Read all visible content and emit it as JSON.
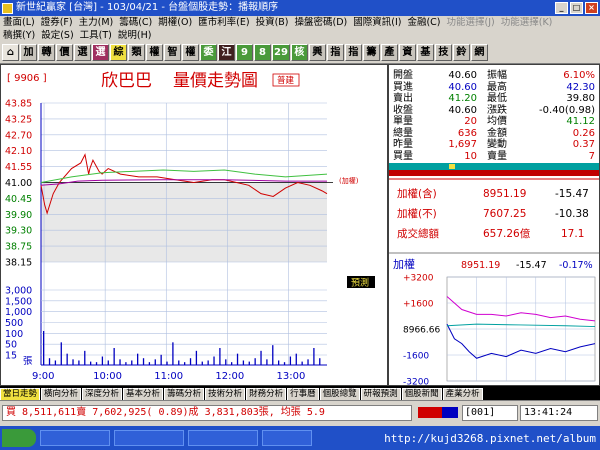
{
  "window": {
    "title": "新世紀贏家 [台灣] - 103/04/21 - 台盤個股走勢：播報順序"
  },
  "menu": {
    "row1": [
      "畫面(L)",
      "證券(F)",
      "主力(M)",
      "籌碼(C)",
      "期權(O)",
      "匯市利率(E)",
      "投資(B)",
      "操盤密碼(D)",
      "國際資訊(I)",
      "金融(C)",
      "功能選擇(J)",
      "功能選擇(K)"
    ],
    "row2": [
      "稿撰(Y)",
      "設定(S)",
      "工具(T)",
      "說明(H)"
    ]
  },
  "toolbar": [
    "加",
    "轉",
    "價",
    "選",
    "選",
    "綜",
    "類",
    "權",
    "智",
    "權",
    "委",
    "江",
    "9",
    "8",
    "29",
    "核",
    "興",
    "指",
    "指",
    "籌",
    "產",
    "資",
    "基",
    "技",
    "鈴",
    "網"
  ],
  "stock": {
    "code": "[ 9906 ]",
    "name": "欣巴巴",
    "chart_title": "量價走勢圖",
    "badge": "普建",
    "ref_label": "(加權)",
    "predict": "預測"
  },
  "quote": {
    "rows": [
      {
        "l1": "開盤",
        "v1": "40.60",
        "c1": "blk",
        "l2": "振幅",
        "v2": "6.10%",
        "c2": "red"
      },
      {
        "l1": "買進",
        "v1": "40.60",
        "c1": "blue",
        "l2": "最高",
        "v2": "42.30",
        "c2": "blue"
      },
      {
        "l1": "賣出",
        "v1": "41.20",
        "c1": "green",
        "l2": "最低",
        "v2": "39.80",
        "c2": "blk"
      },
      {
        "l1": "收盤",
        "v1": "40.60",
        "c1": "blk",
        "l2": "漲跌",
        "v2": "-0.40(0.98)",
        "c2": "blk"
      },
      {
        "l1": "單量",
        "v1": "20",
        "c1": "red",
        "l2": "均價",
        "v2": "41.12",
        "c2": "green"
      },
      {
        "l1": "總量",
        "v1": "636",
        "c1": "red",
        "l2": "金額",
        "v2": "0.26",
        "c2": "red"
      },
      {
        "l1": "昨量",
        "v1": "1,697",
        "c1": "red",
        "l2": "變動",
        "v2": "0.37",
        "c2": "red"
      },
      {
        "l1": "買量",
        "v1": "10",
        "c1": "red",
        "l2": "賣量",
        "v2": "7",
        "c2": "red"
      }
    ]
  },
  "index": {
    "r1": {
      "label": "加權(含)",
      "val": "8951.19",
      "chg": "-15.47"
    },
    "r2": {
      "label": "加權(不)",
      "val": "7607.25",
      "chg": "-10.38"
    },
    "r3": {
      "label": "成交總額",
      "val": "657.26億",
      "chg": "17.1"
    },
    "mini_label": "加權",
    "mini_val": "8951.19",
    "mini_chg": "-15.47",
    "mini_pct": "-0.17%",
    "mini_ticks": [
      "+3200",
      "+1600",
      "8966.66",
      "-1600",
      "-3200"
    ]
  },
  "tabs": [
    "當日走勢",
    "橫向分析",
    "深度分析",
    "基本分析",
    "籌碼分析",
    "技術分析",
    "財務分析",
    "行事曆",
    "個股總覽",
    "研報預測",
    "個股新聞",
    "產業分析"
  ],
  "status": {
    "line": "買 8,511,611賣 7,602,925( 0.89)成 3,831,803張, 均張 5.9",
    "code_box": "001",
    "time": "13:41:24"
  },
  "watermark": "http://kujd3268.pixnet.net/album",
  "chart_data": [
    {
      "type": "line",
      "title": "量價走勢圖",
      "y_ticks": [
        "43.85",
        "43.25",
        "42.70",
        "42.10",
        "41.55",
        "41.00",
        "40.45",
        "39.90",
        "39.30",
        "38.75",
        "38.15"
      ],
      "x_ticks": [
        "9:00",
        "10:00",
        "11:00",
        "12:00",
        "13:00"
      ],
      "ylim": [
        38.15,
        43.85
      ],
      "ref": 41.0,
      "series": [
        {
          "name": "price",
          "color": "#d00000",
          "x": [
            0,
            0.06,
            0.1,
            0.2,
            0.3,
            0.5,
            0.65,
            0.72,
            0.78,
            0.8,
            0.85,
            0.9,
            0.95,
            1.0,
            1.1,
            1.3,
            1.6,
            1.9,
            2.2,
            2.5,
            2.8,
            3.0,
            3.2,
            3.4,
            3.6,
            3.8,
            4.0,
            4.2,
            4.4,
            4.6,
            4.68
          ],
          "y": [
            40.9,
            40.2,
            39.9,
            40.6,
            41.0,
            41.5,
            41.7,
            42.0,
            41.3,
            41.5,
            41.8,
            41.6,
            41.4,
            41.3,
            41.5,
            41.3,
            41.2,
            41.2,
            41.1,
            41.0,
            41.1,
            41.1,
            41.0,
            40.9,
            40.6,
            40.5,
            40.8,
            41.0,
            40.9,
            40.7,
            40.6
          ]
        },
        {
          "name": "avg",
          "color": "#a000a0",
          "x": [
            0,
            0.3,
            0.6,
            1.0,
            2.0,
            3.0,
            4.0,
            4.68
          ],
          "y": [
            40.9,
            40.95,
            41.05,
            41.08,
            41.1,
            41.1,
            41.05,
            41.05
          ]
        },
        {
          "name": "index",
          "color": "#40c040",
          "x": [
            0,
            0.5,
            1.0,
            1.5,
            2.0,
            2.5,
            3.0,
            3.5,
            4.0,
            4.68
          ],
          "y": [
            41.0,
            41.2,
            41.35,
            41.4,
            41.45,
            41.4,
            41.45,
            41.3,
            41.2,
            41.3
          ]
        }
      ]
    },
    {
      "type": "bar",
      "y_ticks": [
        "3,000",
        "1,500",
        "1,000",
        "500",
        "100",
        "50",
        "15"
      ],
      "unit": "張",
      "values": [
        60,
        12,
        8,
        40,
        20,
        10,
        8,
        25,
        6,
        5,
        15,
        8,
        30,
        10,
        5,
        8,
        20,
        12,
        5,
        10,
        18,
        6,
        40,
        8,
        5,
        12,
        25,
        6,
        8,
        15,
        30,
        10,
        5,
        20,
        8,
        6,
        12,
        25,
        10,
        35,
        8,
        5,
        15,
        20,
        6,
        10,
        30,
        12
      ]
    },
    {
      "type": "line",
      "series": [
        {
          "name": "idx1",
          "color": "#0000c0",
          "x": [
            0,
            0.05,
            0.1,
            0.15,
            0.2,
            0.3,
            0.4,
            0.5,
            0.6,
            0.7,
            0.8,
            0.9,
            1.0
          ],
          "y": [
            300,
            -600,
            -900,
            -1400,
            -1800,
            -1500,
            -1700,
            -1300,
            -1500,
            -1200,
            -1400,
            -1100,
            -900
          ]
        },
        {
          "name": "idx2",
          "color": "#d000d0",
          "x": [
            0,
            0.1,
            0.2,
            0.3,
            0.4,
            0.5,
            0.6,
            0.7,
            0.8,
            0.9,
            1.0
          ],
          "y": [
            2000,
            1200,
            900,
            900,
            800,
            1000,
            900,
            700,
            800,
            600,
            500
          ]
        },
        {
          "name": "idx3",
          "color": "#00a0a0",
          "x": [
            0,
            0.2,
            0.5,
            0.8,
            1.0
          ],
          "y": [
            200,
            300,
            250,
            200,
            150
          ]
        }
      ]
    }
  ]
}
